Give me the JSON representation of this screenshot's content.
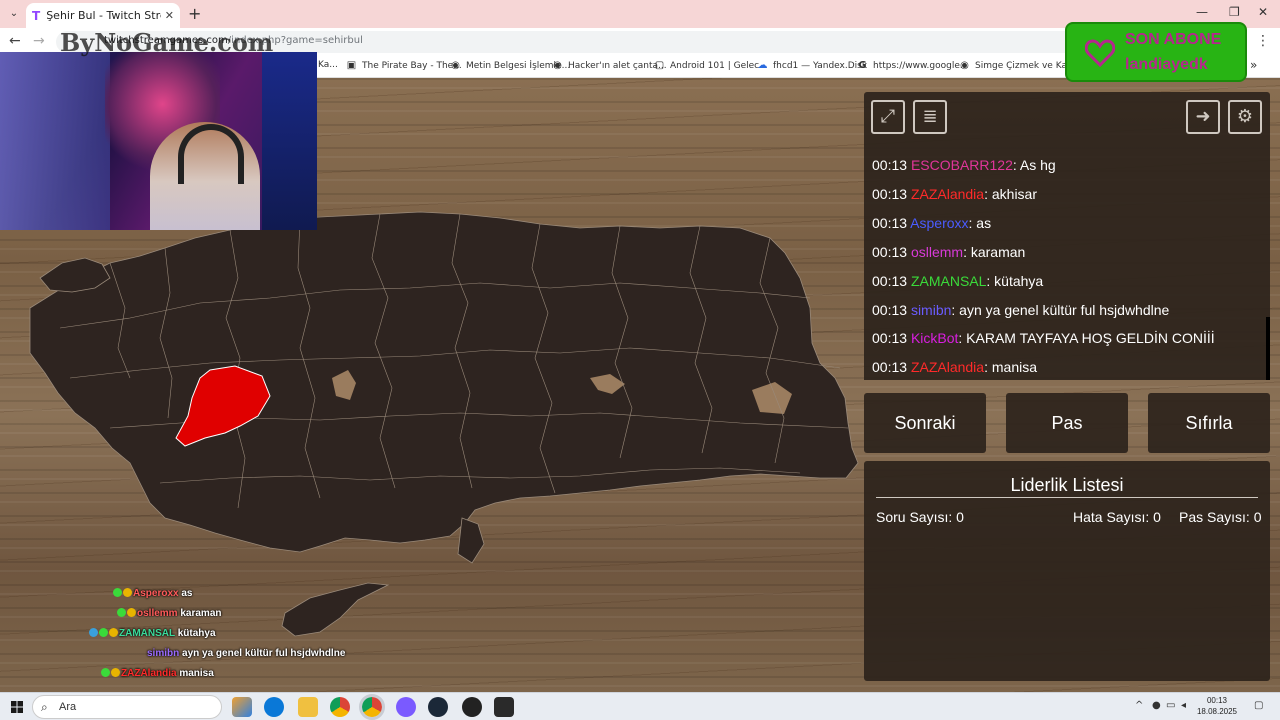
{
  "browser": {
    "tab_title": "Şehir Bul - Twitch Stream Games",
    "tab_favicon": "T",
    "url_domain": "twitchstreamgames.com",
    "url_path": "/index.php?game=sehirbul",
    "bookmarks": [
      "Ka...",
      "The Pirate Bay - The...",
      "Metin Belgesi İşlemle...",
      "Hacker'ın alet çanta...",
      "Android 101 | Gelec...",
      "fhcd1 — Yandex.Disk",
      "https://www.google...",
      "Simge Çizmek ve Ka..."
    ]
  },
  "logo_watermark": "ByNoGame.com",
  "sub_alert": {
    "title": "SON ABONE",
    "user": "landiayedk",
    "colors": {
      "bg": "#28b414",
      "text": "#b6268e"
    }
  },
  "chat": [
    {
      "time": "00:13",
      "user": "ESCOBARR122",
      "color": "#e0359a",
      "text": ": As hg"
    },
    {
      "time": "00:13",
      "user": "ZAZAlandia",
      "color": "#ff2a2a",
      "text": ": akhisar"
    },
    {
      "time": "00:13",
      "user": "Asperoxx",
      "color": "#4a5cff",
      "text": ": as"
    },
    {
      "time": "00:13",
      "user": "osllemm",
      "color": "#d83ad8",
      "text": ": karaman"
    },
    {
      "time": "00:13",
      "user": "ZAMANSAL",
      "color": "#3adb3a",
      "text": ": kütahya"
    },
    {
      "time": "00:13",
      "user": "simibn",
      "color": "#6a5cff",
      "text": ": ayn ya genel kültür ful hsjdwhdlne"
    },
    {
      "time": "00:13",
      "user": "KickBot",
      "color": "#d81ee0",
      "text": ": KARAM TAYFAYA HOŞ GELDİN CONİİİ"
    },
    {
      "time": "00:13",
      "user": "ZAZAlandia",
      "color": "#ff2a2a",
      "text": ": manisa"
    }
  ],
  "controls": {
    "next": "Sonraki",
    "pass": "Pas",
    "reset": "Sıfırla"
  },
  "leaderboard": {
    "title": "Liderlik Listesi",
    "question_label": "Soru Sayısı: 0",
    "error_label": "Hata Sayısı: 0",
    "pass_label": "Pas Sayısı: 0"
  },
  "overlay_chat": [
    {
      "user": "Asperoxx",
      "text": "as",
      "color": "#ff5a5a"
    },
    {
      "user": "osllemm",
      "text": "karaman",
      "color": "#ff5a5a"
    },
    {
      "user": "ZAMANSAL",
      "text": "kütahya",
      "color": "#3adb9a"
    },
    {
      "user": "simibn",
      "text": "ayn ya genel kültür ful hsjdwhdlne",
      "color": "#9a6aff"
    },
    {
      "user": "ZAZAlandia",
      "text": "manisa",
      "color": "#ff2a2a"
    }
  ],
  "taskbar": {
    "search_placeholder": "Ara",
    "time": "00:13",
    "date": "18.08.2025"
  },
  "icons": [
    "fullscreen-icon",
    "list-icon",
    "logout-icon",
    "gear-icon",
    "heart-icon",
    "windows-start-icon",
    "search-icon"
  ]
}
